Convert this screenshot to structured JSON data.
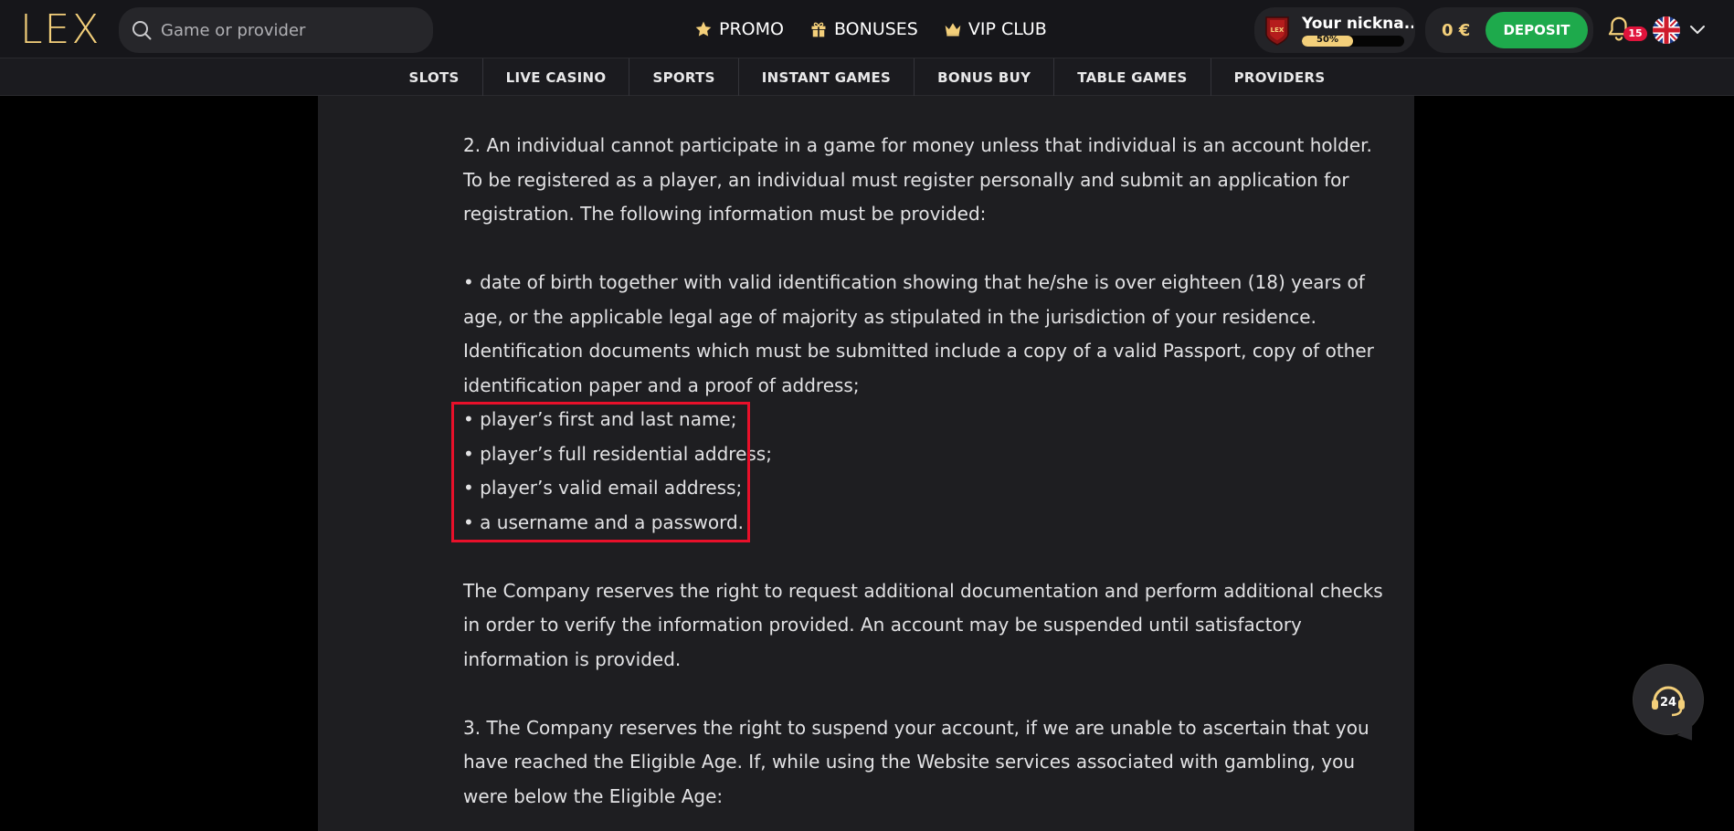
{
  "header": {
    "logo_text": "LEX",
    "search": {
      "placeholder": "Game or provider"
    },
    "nav": [
      {
        "label": "PROMO",
        "icon": "star-icon"
      },
      {
        "label": "BONUSES",
        "icon": "gift-icon"
      },
      {
        "label": "VIP CLUB",
        "icon": "crown-icon"
      }
    ],
    "user": {
      "nickname": "Your nickna...",
      "avatar_text": "LEX",
      "level_progress_label": "50%",
      "level_progress": 0.5
    },
    "balance": "0 €",
    "deposit_label": "DEPOSIT",
    "notifications_count": "15",
    "language_icon": "uk-flag-icon"
  },
  "categories": [
    "SLOTS",
    "LIVE CASINO",
    "SPORTS",
    "INSTANT GAMES",
    "BONUS BUY",
    "TABLE GAMES",
    "PROVIDERS"
  ],
  "article": {
    "para_2": "2. An individual cannot participate in a game for money unless that individual is an account holder. To be registered as a player, an individual must register personally and submit an application for registration. The following information must be provided:",
    "bullet_dob": "• date of birth together with valid identification showing that he/she is over eighteen (18) years of age, or the applicable legal age of majority as stipulated in the jurisdiction of your residence. Identification documents which must be submitted include a copy of a valid Passport, copy of other identification paper and a proof of address;",
    "bullet_name": "• player’s first and last name;",
    "bullet_address": "• player’s full residential address;",
    "bullet_email": "• player’s valid email address;",
    "bullet_credentials": "• a username and a password.",
    "para_company": "The Company reserves the right to request additional documentation and perform additional checks in order to verify the information provided. An account may be suspended until satisfactory information is provided.",
    "para_3": "3. The Company reserves the right to suspend your account, if we are unable to ascertain that you have reached the Eligible Age. If, while using the Website services associated with gambling, you were below the Eligible Age:"
  },
  "support": {
    "label": "24"
  },
  "colors": {
    "accent_gold": "#f3cf7a",
    "deposit_green": "#1eaa4c",
    "badge_red": "#e0143c",
    "highlight_red": "#e8102a"
  }
}
